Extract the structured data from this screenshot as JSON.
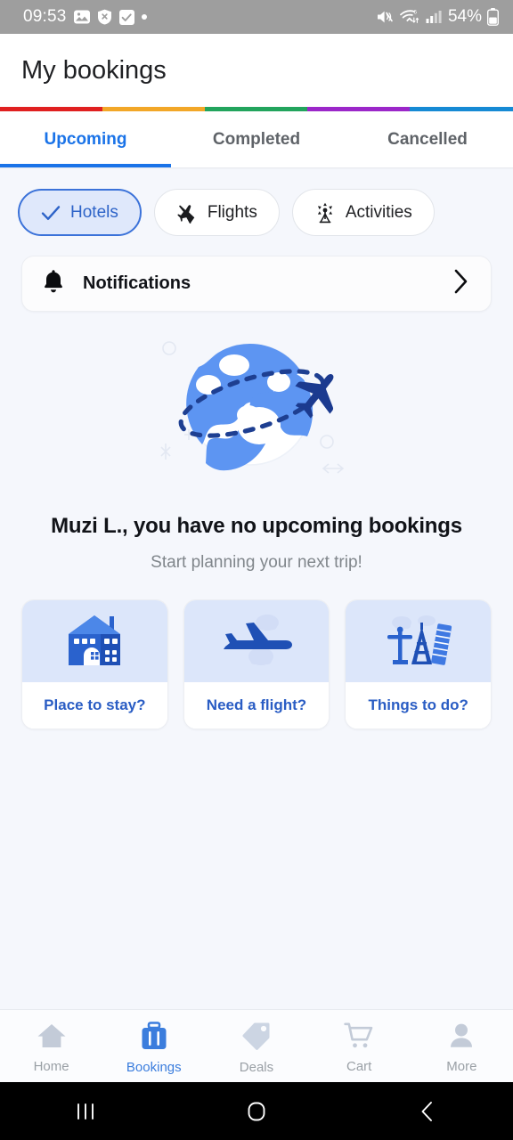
{
  "status_bar": {
    "time": "09:53",
    "battery_percent": "54%",
    "icons": [
      "photo-icon",
      "shield-x-icon",
      "checkbox-icon",
      "dot-icon",
      "mute-icon",
      "wifi-icon",
      "signal-icon",
      "battery-icon"
    ]
  },
  "header": {
    "title": "My bookings"
  },
  "color_strip": [
    {
      "name": "red",
      "color": "#e02020",
      "flex": 115
    },
    {
      "name": "amber",
      "color": "#f2a728",
      "flex": 115
    },
    {
      "name": "green",
      "color": "#22a45d",
      "flex": 115
    },
    {
      "name": "purple",
      "color": "#9b27c9",
      "flex": 115
    },
    {
      "name": "blue",
      "color": "#168ad4",
      "flex": 116
    }
  ],
  "tabs": [
    {
      "label": "Upcoming",
      "active": true
    },
    {
      "label": "Completed",
      "active": false
    },
    {
      "label": "Cancelled",
      "active": false
    }
  ],
  "filter_chips": [
    {
      "label": "Hotels",
      "icon": "check-icon",
      "selected": true
    },
    {
      "label": "Flights",
      "icon": "airplane-icon",
      "selected": false
    },
    {
      "label": "Activities",
      "icon": "ferris-wheel-icon",
      "selected": false
    }
  ],
  "notifications_row": {
    "label": "Notifications",
    "icon": "bell-icon",
    "chevron": "chevron-right-icon"
  },
  "empty_state": {
    "illustration": "globe-airplane-illustration",
    "headline": "Muzi L., you have no upcoming bookings",
    "subhead": "Start planning your next trip!"
  },
  "suggestion_cards": [
    {
      "label": "Place to stay?",
      "icon": "house-icon"
    },
    {
      "label": "Need a flight?",
      "icon": "takeoff-plane-icon"
    },
    {
      "label": "Things to do?",
      "icon": "landmarks-icon"
    }
  ],
  "bottom_nav": [
    {
      "label": "Home",
      "icon": "home-icon",
      "active": false
    },
    {
      "label": "Bookings",
      "icon": "suitcase-icon",
      "active": true
    },
    {
      "label": "Deals",
      "icon": "tag-icon",
      "active": false
    },
    {
      "label": "Cart",
      "icon": "cart-icon",
      "active": false
    },
    {
      "label": "More",
      "icon": "person-icon",
      "active": false
    }
  ],
  "system_nav": [
    {
      "name": "recents-button",
      "glyph": "|||"
    },
    {
      "name": "home-button",
      "glyph": "O"
    },
    {
      "name": "back-button",
      "glyph": "<"
    }
  ],
  "colors": {
    "accent_blue": "#1a73e8",
    "chip_selected_bg": "#dfe8fb",
    "card_top_bg": "#dce6fa",
    "page_bg": "#f5f7fc",
    "status_bar_bg": "#9e9e9e"
  }
}
